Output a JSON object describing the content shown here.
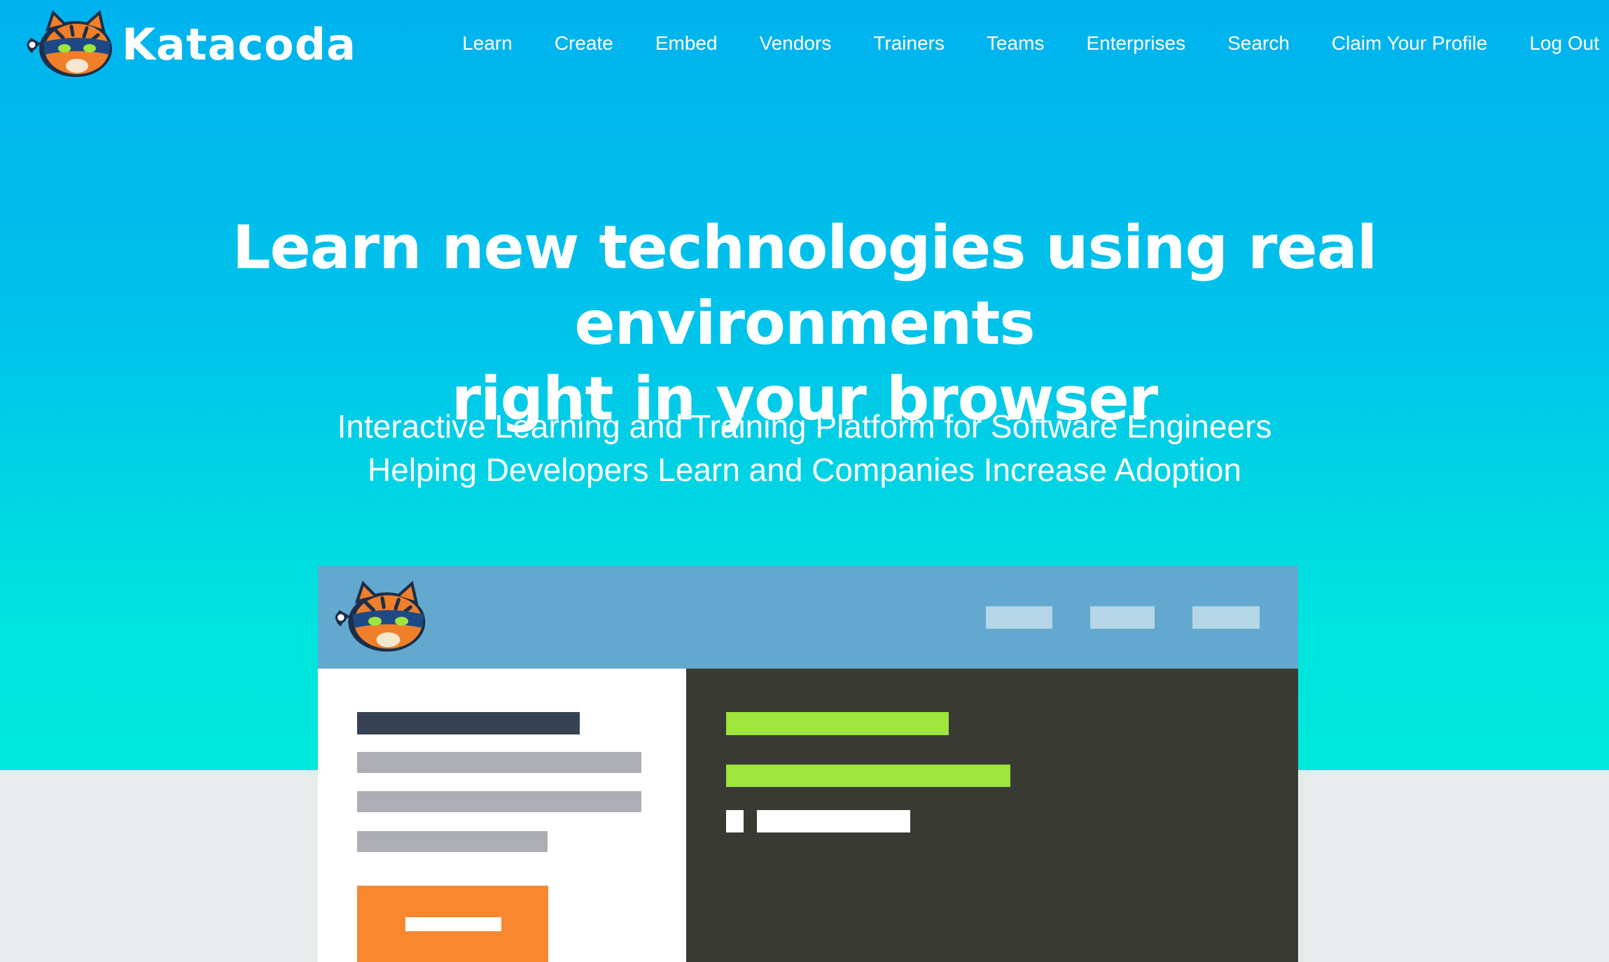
{
  "brand": {
    "name": "Katacoda",
    "logo_icon": "tiger-ninja-mascot-icon"
  },
  "nav": {
    "items": [
      {
        "label": "Learn"
      },
      {
        "label": "Create"
      },
      {
        "label": "Embed"
      },
      {
        "label": "Vendors"
      },
      {
        "label": "Trainers"
      },
      {
        "label": "Teams"
      },
      {
        "label": "Enterprises"
      },
      {
        "label": "Search"
      },
      {
        "label": "Claim Your Profile"
      },
      {
        "label": "Log Out"
      }
    ]
  },
  "hero": {
    "headline_line1": "Learn new technologies using real environments",
    "headline_line2": "right in your browser",
    "subline_line1": "Interactive Learning and Training Platform for Software Engineers",
    "subline_line2": "Helping Developers Learn and Companies Increase Adoption"
  },
  "colors": {
    "hero_top": "#00b2ee",
    "hero_bottom": "#00e8dc",
    "page_background": "#e8ebec",
    "illustration_header": "#63a9cf",
    "terminal_background": "#3a3a35",
    "terminal_green": "#9ee53d",
    "cta_orange": "#f7882f",
    "title_bar_dark": "#374254",
    "text_bar_gray": "#acaeb4"
  }
}
